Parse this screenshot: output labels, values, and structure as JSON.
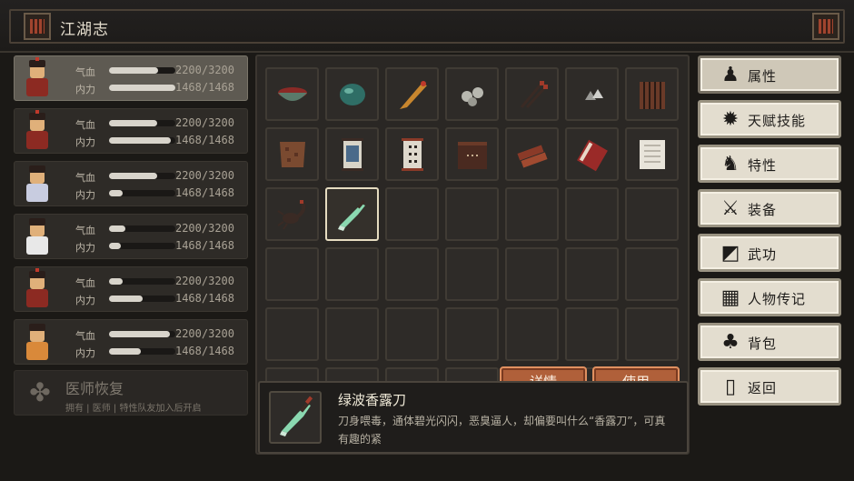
{
  "header": {
    "title": "江湖志"
  },
  "party": [
    {
      "hp_label": "气血",
      "mp_label": "内力",
      "hp": "2200/3200",
      "mp": "1468/1468",
      "hp_frac": 0.74,
      "mp_frac": 1.0,
      "outfit": "body",
      "hat": "red"
    },
    {
      "hp_label": "气血",
      "mp_label": "内力",
      "hp": "2200/3200",
      "mp": "1468/1468",
      "hp_frac": 0.72,
      "mp_frac": 0.93,
      "outfit": "body",
      "hat": "red"
    },
    {
      "hp_label": "气血",
      "mp_label": "内力",
      "hp": "2200/3200",
      "mp": "1468/1468",
      "hp_frac": 0.72,
      "mp_frac": 0.2,
      "outfit": "blue",
      "hat": ""
    },
    {
      "hp_label": "气血",
      "mp_label": "内力",
      "hp": "2200/3200",
      "mp": "1468/1468",
      "hp_frac": 0.25,
      "mp_frac": 0.18,
      "outfit": "white",
      "hat": ""
    },
    {
      "hp_label": "气血",
      "mp_label": "内力",
      "hp": "2200/3200",
      "mp": "1468/1468",
      "hp_frac": 0.2,
      "mp_frac": 0.5,
      "outfit": "body",
      "hat": "red"
    },
    {
      "hp_label": "气血",
      "mp_label": "内力",
      "hp": "2200/3200",
      "mp": "1468/1468",
      "hp_frac": 0.92,
      "mp_frac": 0.48,
      "outfit": "orange",
      "hat": ""
    }
  ],
  "doctor": {
    "title": "医师恢复",
    "subtitle": "拥有 | 医师 | 特性队友加入后开启"
  },
  "inventory": {
    "rows": 6,
    "cols": 7,
    "selected_index": 15,
    "items": [
      {
        "icon": "bowl-icon",
        "color": "#8a2a26"
      },
      {
        "icon": "jade-icon",
        "color": "#2f6e66"
      },
      {
        "icon": "feather-icon",
        "color": "#c8862e"
      },
      {
        "icon": "stones-icon",
        "color": "#b8b8b0"
      },
      {
        "icon": "darts-icon",
        "color": "#a03a2a"
      },
      {
        "icon": "caltrops-icon",
        "color": "#9a9a96"
      },
      {
        "icon": "cage-icon",
        "color": "#6a3a28"
      },
      {
        "icon": "fur-icon",
        "color": "#7a4a30"
      },
      {
        "icon": "scroll-blue-icon",
        "color": "#4a6a8a"
      },
      {
        "icon": "scroll-dice-icon",
        "color": "#ded8cc"
      },
      {
        "icon": "chest-icon",
        "color": "#4a2a20"
      },
      {
        "icon": "wood-logs-icon",
        "color": "#8a3a28"
      },
      {
        "icon": "red-book-icon",
        "color": "#9a2a28"
      },
      {
        "icon": "paper-sheet-icon",
        "color": "#e8e4da"
      },
      {
        "icon": "scorpion-icon",
        "color": "#3a2a24"
      },
      {
        "icon": "green-blade-icon",
        "color": "#8ad8b0"
      }
    ]
  },
  "detail": {
    "name": "绿波香露刀",
    "description": "刀身喂毒，通体碧光闪闪，恶臭逼人，却偏要叫什么“香露刀”，可真有趣的紧"
  },
  "actions": {
    "details_label": "详情",
    "use_label": "使用"
  },
  "menu": [
    {
      "label": "属性",
      "icon": "person-icon",
      "glyph": "♟",
      "active": true
    },
    {
      "label": "天赋技能",
      "icon": "talent-icon",
      "glyph": "✹",
      "active": false
    },
    {
      "label": "特性",
      "icon": "trait-icon",
      "glyph": "♞",
      "active": false
    },
    {
      "label": "装备",
      "icon": "sword-icon",
      "glyph": "⚔",
      "active": false
    },
    {
      "label": "武功",
      "icon": "manual-icon",
      "glyph": "◩",
      "active": false
    },
    {
      "label": "人物传记",
      "icon": "biography-icon",
      "glyph": "▦",
      "active": false
    },
    {
      "label": "背包",
      "icon": "bag-icon",
      "glyph": "♣",
      "active": false
    },
    {
      "label": "返回",
      "icon": "door-icon",
      "glyph": "▯",
      "active": false
    }
  ]
}
